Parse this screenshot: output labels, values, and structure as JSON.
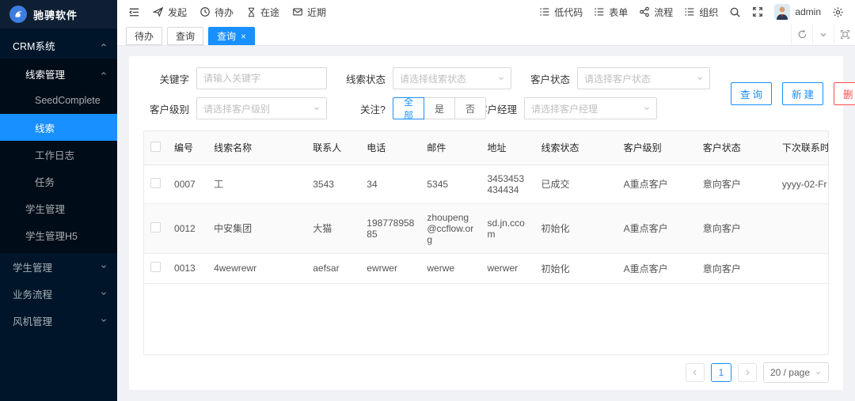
{
  "colors": {
    "primary": "#1890ff",
    "danger": "#ff4d4f",
    "sidebar_bg": "#001529",
    "submenu_bg": "#000c17",
    "content_bg": "#f0f2f5"
  },
  "brand": {
    "name": "驰骋软件"
  },
  "topbar": {
    "quick": [
      {
        "label": "发起"
      },
      {
        "label": "待办"
      },
      {
        "label": "在途"
      },
      {
        "label": "近期"
      }
    ],
    "modules": [
      {
        "label": "低代码"
      },
      {
        "label": "表单"
      },
      {
        "label": "流程"
      },
      {
        "label": "组织"
      }
    ],
    "user": "admin"
  },
  "tabs": [
    {
      "label": "待办"
    },
    {
      "label": "查询"
    },
    {
      "label": "查询",
      "close": "×",
      "active": true
    }
  ],
  "sidebar": {
    "items": [
      {
        "label": "CRM系统"
      },
      {
        "label": "线索管理"
      },
      {
        "label": "SeedComplete"
      },
      {
        "label": "线索"
      },
      {
        "label": "工作日志"
      },
      {
        "label": "任务"
      },
      {
        "label": "学生管理"
      },
      {
        "label": "学生管理H5"
      },
      {
        "label": "学生管理"
      },
      {
        "label": "业务流程"
      },
      {
        "label": "风机管理"
      }
    ]
  },
  "filters": {
    "row1": [
      {
        "label": "关键字",
        "placeholder": "请输入关键字"
      },
      {
        "label": "线索状态",
        "placeholder": "请选择线索状态"
      },
      {
        "label": "客户状态",
        "placeholder": "请选择客户状态"
      }
    ],
    "row2": [
      {
        "label": "客户级别",
        "placeholder": "请选择客户级别"
      },
      {
        "label": "关注?",
        "options": [
          "全部",
          "是",
          "否"
        ],
        "selected": "全部"
      },
      {
        "label": "客户经理",
        "placeholder": "请选择客户经理"
      }
    ]
  },
  "actions": {
    "search": "查询",
    "create": "新建",
    "delete": "删除",
    "settings": "设置"
  },
  "table": {
    "columns": [
      "编号",
      "线索名称",
      "联系人",
      "电话",
      "邮件",
      "地址",
      "线索状态",
      "客户级别",
      "客户状态",
      "下次联系时间"
    ],
    "rows": [
      [
        "0007",
        "工",
        "3543",
        "34",
        "5345",
        "3453453434434",
        "已成交",
        "A重点客户",
        "意向客户",
        "yyyy-02-Fr"
      ],
      [
        "0012",
        "中安集团",
        "大猫",
        "19877895885",
        "zhoupeng@ccflow.org",
        "sd.jn.ccom",
        "初始化",
        "A重点客户",
        "意向客户",
        ""
      ],
      [
        "0013",
        "4wewrewr",
        "aefsar",
        "ewrwer",
        "werwe",
        "werwer",
        "初始化",
        "A重点客户",
        "意向客户",
        ""
      ]
    ]
  },
  "pagination": {
    "current": "1",
    "page_size": "20 / page"
  }
}
